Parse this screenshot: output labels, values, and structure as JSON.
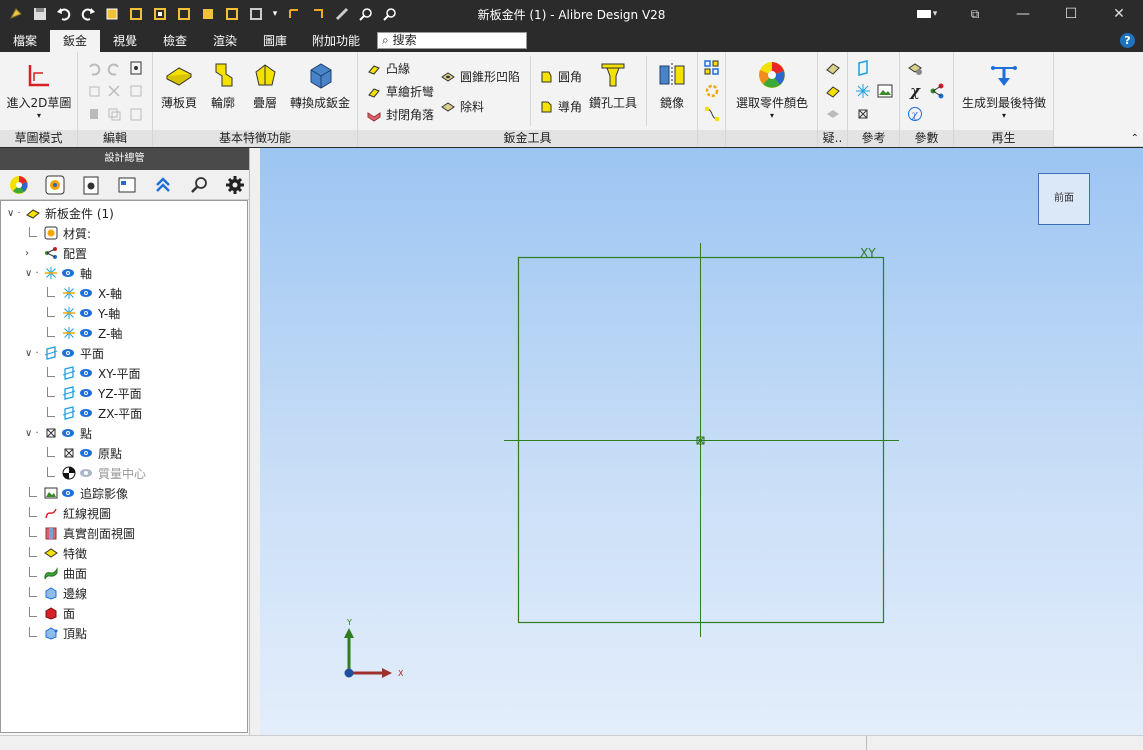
{
  "window": {
    "title": "新板金件 (1) - Alibre Design V28"
  },
  "menu_tabs": [
    "檔案",
    "鈑金",
    "視覺",
    "檢查",
    "渲染",
    "圖庫",
    "附加功能"
  ],
  "search": {
    "label": "搜索"
  },
  "ribbon": {
    "sketch_mode": {
      "button": "進入2D草圖",
      "group": "草圖模式"
    },
    "edit": {
      "group": "編輯"
    },
    "basic_features": {
      "group": "基本特徵功能",
      "buttons": [
        "薄板頁",
        "輪廓",
        "疊層",
        "轉換成鈑金"
      ]
    },
    "sheetmetal_tools": {
      "group": "鈑金工具",
      "items": [
        "凸緣",
        "草繪折彎",
        "封閉角落",
        "圓錐形凹陷",
        "除料",
        "圓角",
        "導角",
        "鑽孔工具",
        "鏡像"
      ]
    },
    "color": {
      "button": "選取零件顏色"
    },
    "truncated_group": {
      "group": "疑.."
    },
    "reference": {
      "group": "參考"
    },
    "parameters": {
      "group": "參數"
    },
    "regen": {
      "button": "生成到最後特徵",
      "group": "再生"
    }
  },
  "design_explorer": {
    "title": "設計總管",
    "tree": [
      {
        "label": "新板金件 (1)",
        "icon": "sheetmetal-part-icon",
        "depth": 0,
        "expander": "v-",
        "eye": false
      },
      {
        "label": "材質:",
        "icon": "material-icon",
        "depth": 1,
        "expander": "",
        "eye": false
      },
      {
        "label": "配置",
        "icon": "configuration-icon",
        "depth": 1,
        "expander": ">",
        "eye": false
      },
      {
        "label": "軸",
        "icon": "axis-icon",
        "depth": 1,
        "expander": "v-",
        "eye": true
      },
      {
        "label": "X-軸",
        "icon": "axis-icon",
        "depth": 2,
        "expander": "",
        "eye": true
      },
      {
        "label": "Y-軸",
        "icon": "axis-icon",
        "depth": 2,
        "expander": "",
        "eye": true
      },
      {
        "label": "Z-軸",
        "icon": "axis-icon",
        "depth": 2,
        "expander": "",
        "eye": true
      },
      {
        "label": "平面",
        "icon": "plane-icon",
        "depth": 1,
        "expander": "v-",
        "eye": true
      },
      {
        "label": "XY-平面",
        "icon": "plane-icon",
        "depth": 2,
        "expander": "",
        "eye": true
      },
      {
        "label": "YZ-平面",
        "icon": "plane-icon",
        "depth": 2,
        "expander": "",
        "eye": true
      },
      {
        "label": "ZX-平面",
        "icon": "plane-icon",
        "depth": 2,
        "expander": "",
        "eye": true
      },
      {
        "label": "點",
        "icon": "point-icon",
        "depth": 1,
        "expander": "v-",
        "eye": true
      },
      {
        "label": "原點",
        "icon": "point-icon",
        "depth": 2,
        "expander": "",
        "eye": true
      },
      {
        "label": "質量中心",
        "icon": "center-of-mass-icon",
        "depth": 2,
        "expander": "",
        "eye": true,
        "dim": true
      },
      {
        "label": "追踪影像",
        "icon": "trace-image-icon",
        "depth": 1,
        "expander": "",
        "eye": true
      },
      {
        "label": "紅線視圖",
        "icon": "redline-icon",
        "depth": 1,
        "expander": "",
        "eye": false
      },
      {
        "label": "真實剖面視圖",
        "icon": "section-view-icon",
        "depth": 1,
        "expander": "",
        "eye": false
      },
      {
        "label": "特徵",
        "icon": "feature-icon",
        "depth": 1,
        "expander": "",
        "eye": false
      },
      {
        "label": "曲面",
        "icon": "surface-icon",
        "depth": 1,
        "expander": "",
        "eye": false
      },
      {
        "label": "邊線",
        "icon": "edge-icon",
        "depth": 1,
        "expander": "",
        "eye": false
      },
      {
        "label": "面",
        "icon": "face-icon",
        "depth": 1,
        "expander": "",
        "eye": false
      },
      {
        "label": "頂點",
        "icon": "vertex-icon",
        "depth": 1,
        "expander": "",
        "eye": false
      }
    ]
  },
  "viewport": {
    "view_cube_label": "前面",
    "plane_label": "XY",
    "triad": {
      "x": "X",
      "y": "Y"
    }
  },
  "colors": {
    "sketch_line": "#2f7d1f",
    "viewport_top": "#9cc5f2",
    "viewport_bottom": "#e4eefb"
  }
}
